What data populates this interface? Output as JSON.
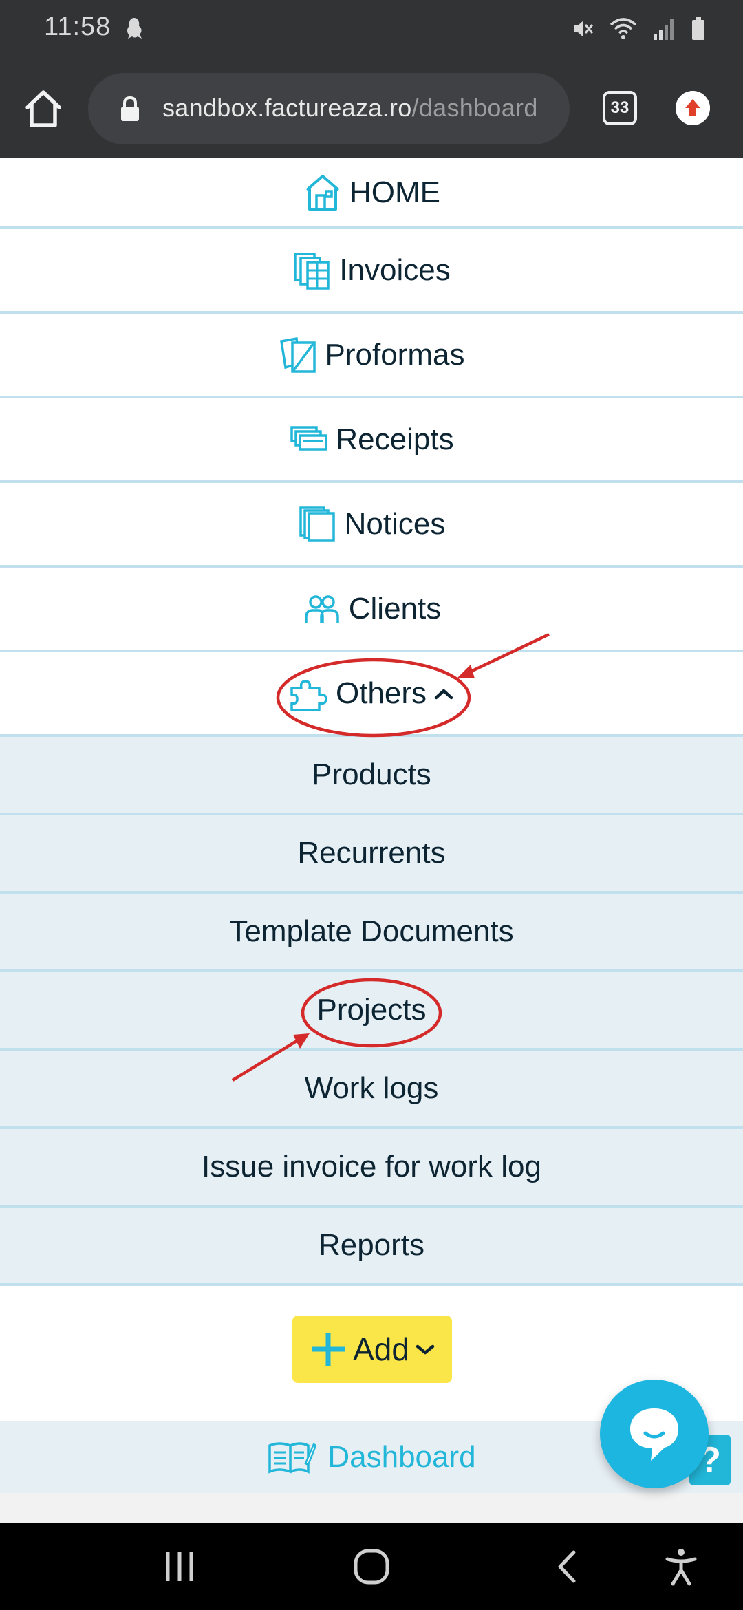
{
  "status_bar": {
    "time": "11:58",
    "icons": [
      "notification-icon",
      "mute-icon",
      "wifi-icon",
      "signal-icon",
      "battery-icon"
    ]
  },
  "browser": {
    "url_host": "sandbox.factureaza.ro",
    "url_path": "/dashboard",
    "tabs_count": "33"
  },
  "menu": {
    "home": "HOME",
    "invoices": "Invoices",
    "proformas": "Proformas",
    "receipts": "Receipts",
    "notices": "Notices",
    "clients": "Clients",
    "others": "Others",
    "others_expanded": true
  },
  "submenu": {
    "products": "Products",
    "recurrents": "Recurrents",
    "template_documents": "Template Documents",
    "projects": "Projects",
    "work_logs": "Work logs",
    "issue_invoice": "Issue invoice for work log",
    "reports": "Reports"
  },
  "add_button": {
    "label": "Add"
  },
  "dashboard": {
    "label": "Dashboard"
  },
  "help": {
    "label": "?"
  },
  "colors": {
    "accent": "#22b6d8",
    "menu_text": "#0d2433",
    "submenu_bg": "#e6eff4",
    "divider": "#bfe0ec",
    "add_button": "#fbe64a",
    "annotation": "#d42a2a",
    "chrome": "#323335"
  }
}
